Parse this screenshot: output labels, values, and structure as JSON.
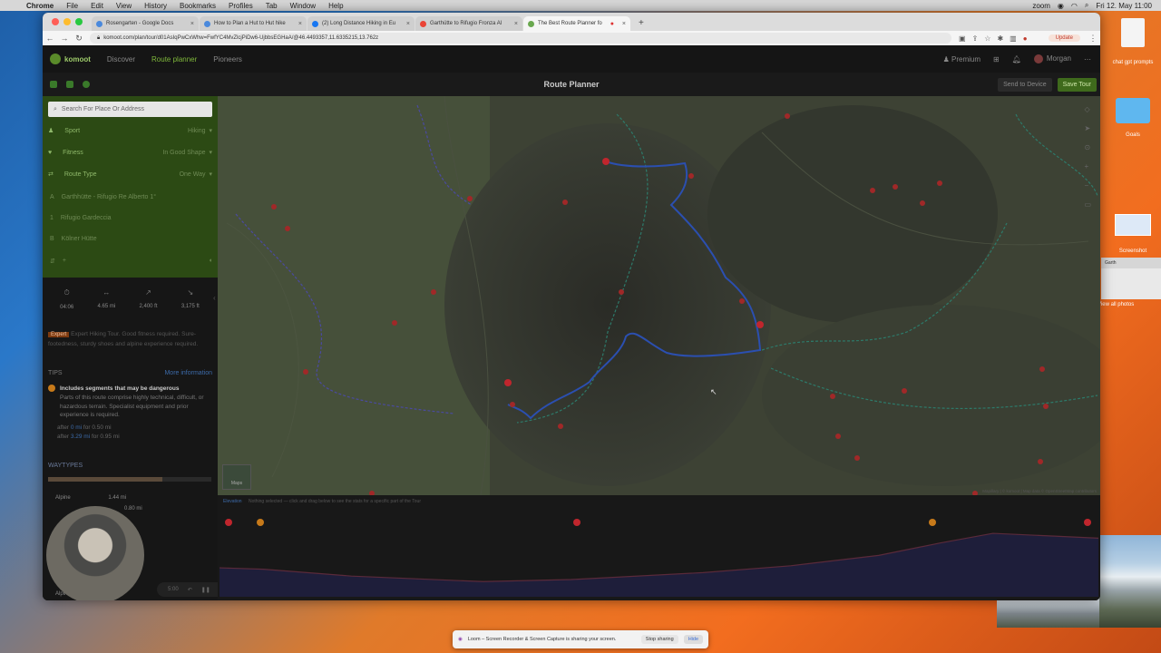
{
  "menubar": {
    "items": [
      "Chrome",
      "File",
      "Edit",
      "View",
      "History",
      "Bookmarks",
      "Profiles",
      "Tab",
      "Window",
      "Help"
    ],
    "zoom": "zoom",
    "clock": "Fri 12. May 11:00"
  },
  "desktop": {
    "icon1": "chat gpt prompts",
    "icon2": "Goals",
    "icon3": "Screenshot",
    "peek_tab": "Garth",
    "view_all": "View all photos"
  },
  "browser": {
    "tabs": [
      "Rosengarten - Google Docs",
      "How to Plan a Hut to Hut hike",
      "(2) Long Distance Hiking in Eu",
      "Garthütte to Rifugio Fronza Al",
      "The Best Route Planner fo"
    ],
    "url": "komoot.com/plan/tour/d01AsIqPwCxWhw=FwfYC4MvZlcjPiDw6-UjbbsEGHaA/@46.4493357,11.6335215,13.762z",
    "update_label": "Update"
  },
  "komoot": {
    "logo": "komoot",
    "nav": [
      "Discover",
      "Route planner",
      "Pioneers"
    ],
    "premium": "Premium",
    "user": "Morgan",
    "title": "Route Planner",
    "send_label": "Send to Device",
    "save_label": "Save Tour",
    "search_placeholder": "Search For Place Or Address",
    "sport_label": "Sport",
    "sport_value": "Hiking",
    "fitness_label": "Fitness",
    "fitness_value": "In Good Shape",
    "route_type_label": "Route Type",
    "route_type_value": "One Way",
    "waypoints": [
      {
        "marker": "A",
        "name": "Garthhütte - Rifugio Re Alberto 1°"
      },
      {
        "marker": "1",
        "name": "Rifugio Gardeccia"
      },
      {
        "marker": "B",
        "name": "Kölner Hütte"
      }
    ],
    "stats": [
      {
        "icon": "⏱",
        "value": "04:06"
      },
      {
        "icon": "↔",
        "value": "4.65 mi"
      },
      {
        "icon": "↗",
        "value": "2,400 ft"
      },
      {
        "icon": "↘",
        "value": "3,175 ft"
      }
    ],
    "difficulty_badge": "Expert",
    "difficulty_text": "Expert Hiking Tour. Good fitness required. Sure-footedness, sturdy shoes and alpine experience required.",
    "tips_label": "TIPS",
    "more_info": "More information",
    "warning_title": "Includes segments that may be dangerous",
    "warning_text": "Parts of this route comprise highly technical, difficult, or hazardous terrain. Specialist equipment and prior experience is required.",
    "after1_prefix": "after",
    "after1_link": "0 mi",
    "after1_suffix": "for 0.50 mi",
    "after2_prefix": "after",
    "after2_link": "3.29 mi",
    "after2_suffix": "for 0.95 mi",
    "waytypes_label": "WAYTYPES",
    "alpine1": "Alpine",
    "alpine1_val": "1.44 mi",
    "alpine2_val": "0.80 mi",
    "alpine3": "Alpine",
    "rec_time": "5:00",
    "map_attr": "Mapillary | © komoot | Map data © OpenStreetMap contributors",
    "maps_thumb": "Maps",
    "elev_label": "Elevation",
    "elev_text": "Nothing selected — click and drag below to see the stats for a specific part of the Tour"
  },
  "banner": {
    "text": "Loom – Screen Recorder & Screen Capture is sharing your screen.",
    "stop": "Stop sharing",
    "hide": "Hide"
  },
  "chart_data": {
    "type": "area",
    "title": "",
    "xlabel": "",
    "ylabel": "",
    "x": [
      0,
      0.05,
      0.15,
      0.3,
      0.4,
      0.55,
      0.65,
      0.75,
      0.82,
      0.88,
      0.95,
      1.0
    ],
    "y": [
      0.42,
      0.4,
      0.3,
      0.22,
      0.25,
      0.35,
      0.45,
      0.6,
      0.78,
      0.92,
      0.88,
      0.85
    ]
  }
}
